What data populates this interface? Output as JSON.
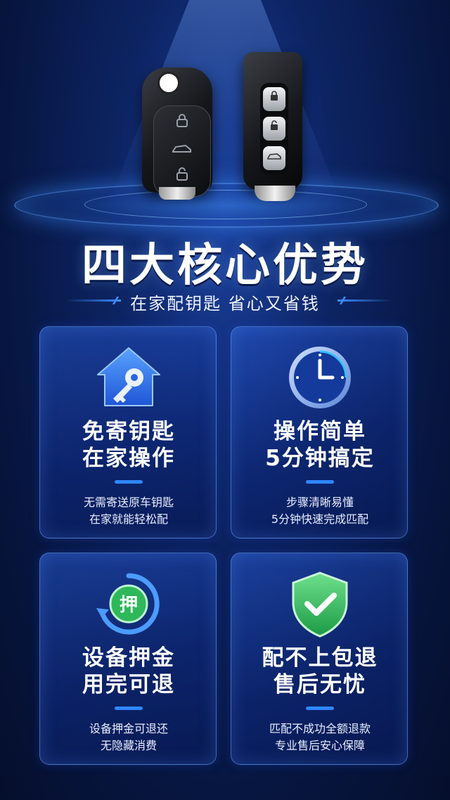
{
  "hero": {
    "title": "四大核心优势",
    "subtitle": "在家配钥匙 省心又省钱"
  },
  "colors": {
    "background": "#071640",
    "accent": "#2f86ff",
    "card_border": "#6eaaff",
    "success_green": "#2fb85a"
  },
  "products": {
    "flip_key_icons": [
      "lock-icon",
      "trunk-icon",
      "unlock-icon"
    ],
    "smart_key_icons": [
      "lock-icon",
      "unlock-icon",
      "trunk-icon"
    ]
  },
  "cards": [
    {
      "icon": "house-key-icon",
      "title_line1": "免寄钥匙",
      "title_line2": "在家操作",
      "desc_line1": "无需寄送原车钥匙",
      "desc_line2": "在家就能轻松配"
    },
    {
      "icon": "clock-icon",
      "title_line1": "操作简单",
      "title_line2": "5分钟搞定",
      "desc_line1": "步骤清晰易懂",
      "desc_line2": "5分钟快速完成匹配"
    },
    {
      "icon": "deposit-refund-icon",
      "icon_text": "押",
      "title_line1": "设备押金",
      "title_line2": "用完可退",
      "desc_line1": "设备押金可退还",
      "desc_line2": "无隐藏消费"
    },
    {
      "icon": "shield-check-icon",
      "title_line1": "配不上包退",
      "title_line2": "售后无忧",
      "desc_line1": "匹配不成功全额退款",
      "desc_line2": "专业售后安心保障"
    }
  ]
}
